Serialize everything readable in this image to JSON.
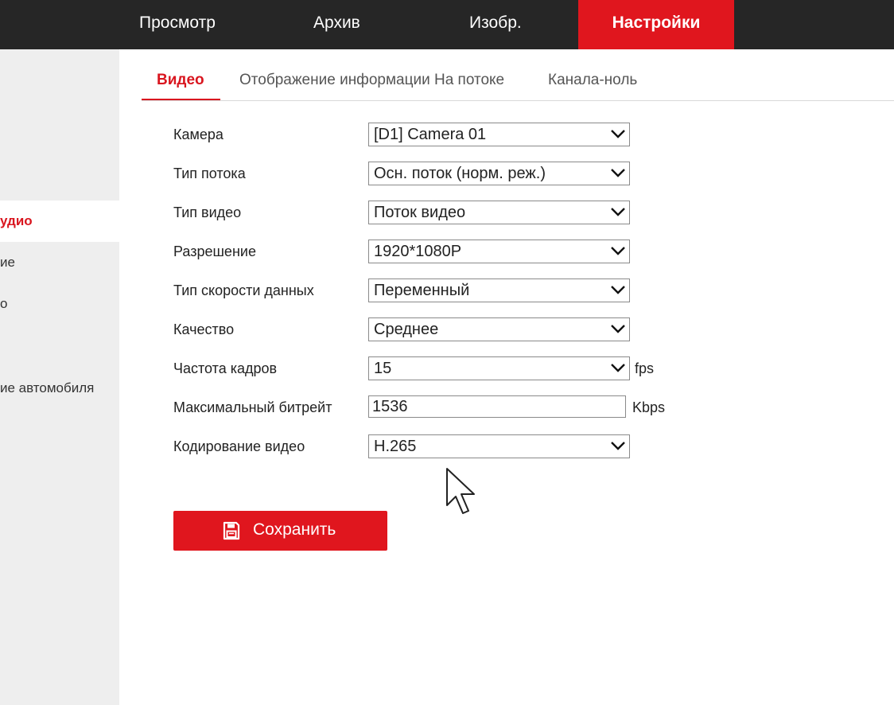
{
  "top_nav": {
    "tabs": [
      {
        "label": "Просмотр"
      },
      {
        "label": "Архив"
      },
      {
        "label": "Изобр."
      },
      {
        "label": "Настройки"
      }
    ],
    "active_tab": "Настройки"
  },
  "sidebar": {
    "items": [
      {
        "label": "удио",
        "active": true
      },
      {
        "label": "ие"
      },
      {
        "label": "о"
      },
      {
        "label": "ие автомобиля"
      }
    ]
  },
  "sub_tabs": {
    "tabs": [
      {
        "label": "Видео"
      },
      {
        "label": "Отображение информации На потоке"
      },
      {
        "label": "Канала-ноль"
      }
    ],
    "active_tab": "Видео"
  },
  "form": {
    "camera": {
      "label": "Камера",
      "value": "[D1] Camera 01"
    },
    "stream_type": {
      "label": "Тип потока",
      "value": "Осн. поток (норм. реж.)"
    },
    "video_type": {
      "label": "Тип видео",
      "value": "Поток видео"
    },
    "resolution": {
      "label": "Разрешение",
      "value": "1920*1080P"
    },
    "bitrate_type": {
      "label": "Тип скорости данных",
      "value": "Переменный"
    },
    "quality": {
      "label": "Качество",
      "value": "Среднее"
    },
    "frame_rate": {
      "label": "Частота кадров",
      "value": "15",
      "unit": "fps"
    },
    "max_bitrate": {
      "label": "Максимальный битрейт",
      "value": "1536",
      "unit": "Kbps"
    },
    "encoding": {
      "label": "Кодирование видео",
      "value": "H.265"
    }
  },
  "save_button": {
    "label": "Сохранить"
  },
  "icons": {
    "save": "floppy-disk-icon",
    "dropdown": "chevron-down-icon",
    "cursor": "mouse-pointer-icon"
  },
  "colors": {
    "accent": "#e0161e",
    "topbar_bg": "#262626",
    "sidebar_bg": "#eeeeee"
  }
}
